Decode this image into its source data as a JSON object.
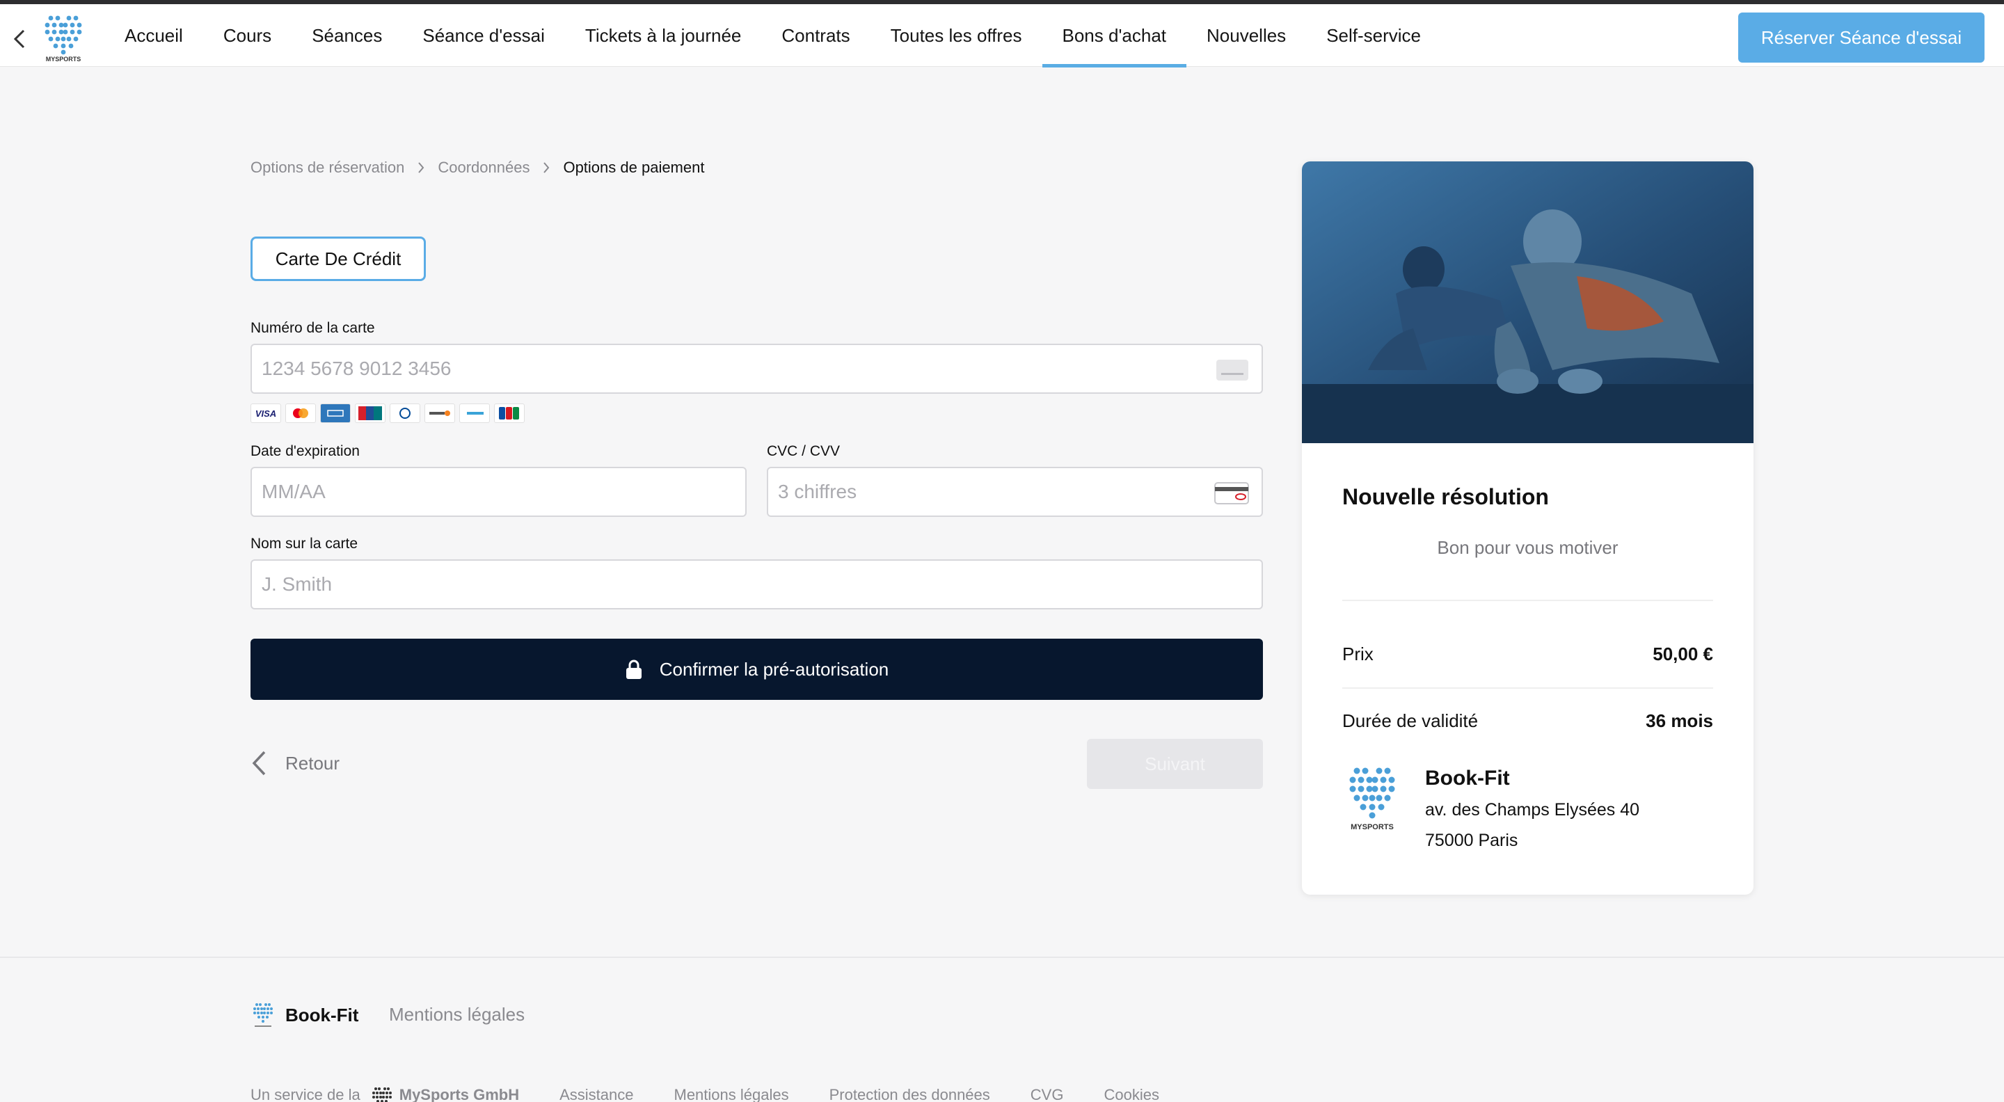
{
  "nav": {
    "back_label": "",
    "logo_text": "MYSPORTS",
    "items": [
      {
        "label": "Accueil"
      },
      {
        "label": "Cours"
      },
      {
        "label": "Séances"
      },
      {
        "label": "Séance d'essai"
      },
      {
        "label": "Tickets à la journée"
      },
      {
        "label": "Contrats"
      },
      {
        "label": "Toutes les offres"
      },
      {
        "label": "Bons d'achat",
        "active": true
      },
      {
        "label": "Nouvelles"
      },
      {
        "label": "Self-service"
      }
    ],
    "cta_label": "Réserver Séance d'essai"
  },
  "breadcrumb": {
    "step1": "Options de réservation",
    "step2": "Coordonnées",
    "step3": "Options de paiement"
  },
  "payment": {
    "method_tab": "Carte De Crédit",
    "card_number_label": "Numéro de la carte",
    "card_number_placeholder": "1234 5678 9012 3456",
    "brands": [
      "visa-icon",
      "mastercard-icon",
      "amex-icon",
      "unionpay-icon",
      "diners-icon",
      "discover-icon",
      "geocard-icon",
      "jcb-icon"
    ],
    "brand_visa_text": "VISA",
    "expiry_label": "Date d'expiration",
    "expiry_placeholder": "MM/AA",
    "cvc_label": "CVC / CVV",
    "cvc_placeholder": "3 chiffres",
    "name_label": "Nom sur la carte",
    "name_placeholder": "J. Smith",
    "confirm_label": "Confirmer la pré-autorisation"
  },
  "actions": {
    "back_label": "Retour",
    "next_label": "Suivant"
  },
  "offer": {
    "title": "Nouvelle résolution",
    "subtitle": "Bon pour vous motiver",
    "price_label": "Prix",
    "price_value": "50,00 €",
    "validity_label": "Durée de validité",
    "validity_value": "36 mois",
    "studio_logo_text": "MYSPORTS",
    "studio_name": "Book-Fit",
    "studio_street": "av. des Champs Elysées 40",
    "studio_city": "75000 Paris"
  },
  "footer": {
    "brand_name": "Book-Fit",
    "legal_link": "Mentions légales",
    "service_prefix": "Un service de la",
    "company": "MySports GmbH",
    "links": [
      "Assistance",
      "Mentions légales",
      "Protection des données",
      "CVG",
      "Cookies"
    ]
  },
  "colors": {
    "accent": "#5aace6",
    "dark_button": "#07172e",
    "page_bg": "#f6f6f7"
  }
}
